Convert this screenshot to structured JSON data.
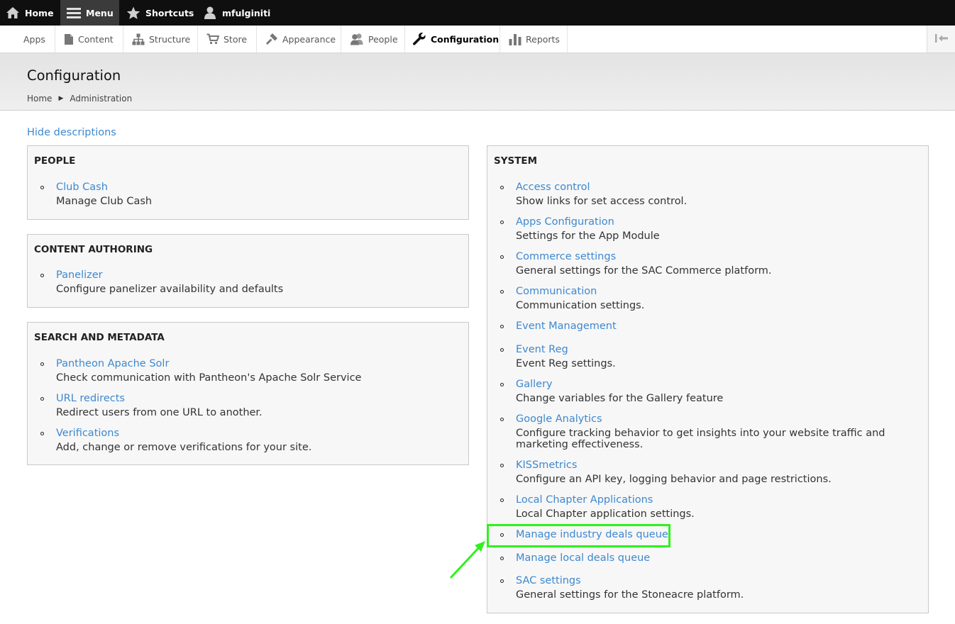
{
  "toolbar": {
    "home": "Home",
    "menu": "Menu",
    "shortcuts": "Shortcuts",
    "user": "mfulginiti"
  },
  "tray": {
    "items": [
      "Apps",
      "Content",
      "Structure",
      "Store",
      "Appearance",
      "People",
      "Configuration",
      "Reports"
    ],
    "active": "Configuration"
  },
  "page": {
    "title": "Configuration",
    "breadcrumb": [
      "Home",
      "Administration"
    ],
    "hide_descriptions": "Hide descriptions"
  },
  "panels": {
    "people": {
      "title": "PEOPLE",
      "items": [
        {
          "link": "Club Cash",
          "desc": "Manage Club Cash"
        }
      ]
    },
    "content_authoring": {
      "title": "CONTENT AUTHORING",
      "items": [
        {
          "link": "Panelizer",
          "desc": "Configure panelizer availability and defaults"
        }
      ]
    },
    "search_metadata": {
      "title": "SEARCH AND METADATA",
      "items": [
        {
          "link": "Pantheon Apache Solr",
          "desc": "Check communication with Pantheon's Apache Solr Service"
        },
        {
          "link": "URL redirects",
          "desc": "Redirect users from one URL to another."
        },
        {
          "link": "Verifications",
          "desc": "Add, change or remove verifications for your site."
        }
      ]
    },
    "system": {
      "title": "SYSTEM",
      "items": [
        {
          "link": "Access control",
          "desc": "Show links for set access control."
        },
        {
          "link": "Apps Configuration",
          "desc": "Settings for the App Module"
        },
        {
          "link": "Commerce settings",
          "desc": "General settings for the SAC Commerce platform."
        },
        {
          "link": "Communication",
          "desc": "Communication settings."
        },
        {
          "link": "Event Management",
          "desc": ""
        },
        {
          "link": "Event Reg",
          "desc": "Event Reg settings."
        },
        {
          "link": "Gallery",
          "desc": "Change variables for the Gallery feature"
        },
        {
          "link": "Google Analytics",
          "desc": "Configure tracking behavior to get insights into your website traffic and marketing effectiveness."
        },
        {
          "link": "KISSmetrics",
          "desc": "Configure an API key, logging behavior and page restrictions."
        },
        {
          "link": "Local Chapter Applications",
          "desc": "Local Chapter application settings."
        },
        {
          "link": "Manage industry deals queue",
          "desc": ""
        },
        {
          "link": "Manage local deals queue",
          "desc": ""
        },
        {
          "link": "SAC settings",
          "desc": "General settings for the Stoneacre platform."
        }
      ]
    }
  },
  "colors": {
    "link": "#3e88cf",
    "highlight": "#2ef21d"
  }
}
